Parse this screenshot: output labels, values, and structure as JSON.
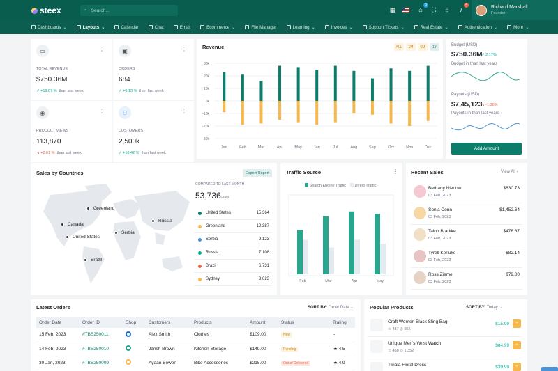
{
  "app": {
    "logo": "steex",
    "search_placeholder": "Search..."
  },
  "topbar": {
    "cart_badge": "5",
    "notif_badge": "4",
    "user_name": "Richard Marshall",
    "user_role": "Founder"
  },
  "menu": [
    {
      "label": "Dashboards",
      "caret": "⌄"
    },
    {
      "label": "Layouts",
      "caret": "⌄"
    },
    {
      "label": "Calendar",
      "caret": ""
    },
    {
      "label": "Chat",
      "caret": ""
    },
    {
      "label": "Email",
      "caret": ""
    },
    {
      "label": "Ecommerce",
      "caret": "⌄"
    },
    {
      "label": "File Manager",
      "caret": ""
    },
    {
      "label": "Learning",
      "caret": "⌄"
    },
    {
      "label": "Invoices",
      "caret": "⌄"
    },
    {
      "label": "Support Tickets",
      "caret": "⌄"
    },
    {
      "label": "Real Estate",
      "caret": "⌄"
    },
    {
      "label": "Authentication",
      "caret": "⌄"
    },
    {
      "label": "More",
      "caret": "⌄"
    }
  ],
  "kpis": {
    "revenue": {
      "label": "TOTAL REVENUE",
      "value": "$750.36M",
      "change": "↗ +19.07 %",
      "suffix": "than last week"
    },
    "orders": {
      "label": "ORDERS",
      "value": "684",
      "change": "↗ +8.13 %",
      "suffix": "than last week"
    },
    "views": {
      "label": "PRODUCT VIEWS",
      "value": "113,870",
      "change": "↘ +2.01 %",
      "suffix": "than last week"
    },
    "customers": {
      "label": "CUSTOMERS",
      "value": "2,500k",
      "change": "↗ +10.42 %",
      "suffix": "than last week"
    }
  },
  "revenue_chart": {
    "title": "Revenue",
    "tabs": [
      "ALL",
      "1M",
      "6M",
      "1Y"
    ]
  },
  "chart_data": {
    "type": "bar",
    "categories": [
      "Jan",
      "Feb",
      "Mar",
      "Apr",
      "May",
      "Jun",
      "Jul",
      "Aug",
      "Sep",
      "Oct",
      "Nov",
      "Dec"
    ],
    "series": [
      {
        "name": "",
        "values": [
          23,
          21,
          16,
          28,
          27,
          25,
          28,
          24,
          18,
          26,
          24,
          28
        ]
      },
      {
        "name": "",
        "values": [
          -9,
          -19,
          -18,
          -15,
          -17,
          -19,
          -17,
          -10,
          -11,
          -18,
          -20,
          -16
        ]
      }
    ],
    "yticks": [
      "30k",
      "20k",
      "10k",
      "0k",
      "-10k",
      "-20k",
      "-30k"
    ],
    "ylim": [
      -30,
      30
    ]
  },
  "budget": {
    "label": "Budget (USD)",
    "value": "$750.36M",
    "change": "↗ 2.17%",
    "sub": "Budget in than last years",
    "payouts_label": "Payouts (USD)",
    "payouts_value": "$7,45,123",
    "payouts_change": "↘ -1.36%",
    "payouts_sub": "Payouts in than last years",
    "button": "Add Amount"
  },
  "sales_countries": {
    "title": "Sales by Countries",
    "export": "Export Report",
    "compared": "COMPARED TO LAST MONTH",
    "total": "53,736",
    "total_unit": "Sales",
    "map_labels": [
      "Greenland",
      "Canada",
      "United States",
      "Serbia",
      "Russia",
      "Brazil"
    ],
    "rows": [
      {
        "name": "United States",
        "value": "15,364",
        "color": "#0d7d6b"
      },
      {
        "name": "Greenland",
        "value": "12,387",
        "color": "#f7b84b"
      },
      {
        "name": "Serbia",
        "value": "9,123",
        "color": "#4b93d6"
      },
      {
        "name": "Russia",
        "value": "7,108",
        "color": "#0ab39c"
      },
      {
        "name": "Brazil",
        "value": "6,731",
        "color": "#f06548"
      },
      {
        "name": "Sydney",
        "value": "3,023",
        "color": "#f7b84b"
      }
    ]
  },
  "traffic": {
    "title": "Traffic Source",
    "legend1": "Search Engine Traffic",
    "legend2": "Direct Traffic",
    "months": [
      "Feb",
      "Mar",
      "Apr",
      "May"
    ]
  },
  "recent_sales": {
    "title": "Recent Sales",
    "view_all": "View All",
    "items": [
      {
        "name": "Bethany Nienow",
        "date": "03 Feb, 2023",
        "amount": "$630.73"
      },
      {
        "name": "Sonia Conn",
        "date": "03 Feb, 2023",
        "amount": "$1,452.64"
      },
      {
        "name": "Talon Bradtke",
        "date": "03 Feb, 2023",
        "amount": "$478.87"
      },
      {
        "name": "Tyrell Kerluke",
        "date": "03 Feb, 2023",
        "amount": "$82.14"
      },
      {
        "name": "Ross Zieme",
        "date": "03 Feb, 2023",
        "amount": "$79.00"
      }
    ]
  },
  "orders": {
    "title": "Latest Orders",
    "sort_label": "SORT BY:",
    "sort_value": "Order Date",
    "headers": [
      "Order Date",
      "Order ID",
      "Shop",
      "Customers",
      "Products",
      "Amount",
      "Status",
      "Rating"
    ],
    "rows": [
      {
        "date": "15 Feb, 2023",
        "id": "#TBS250011",
        "customer": "Alex Smith",
        "product": "Clothes",
        "amount": "$109.00",
        "status": "New",
        "rating": "-"
      },
      {
        "date": "14 Feb, 2023",
        "id": "#TBS250010",
        "customer": "Jansh Brown",
        "product": "Kitchen Storage",
        "amount": "$149.00",
        "status": "Pending",
        "rating": "★ 4.5"
      },
      {
        "date": "30 Jan, 2023",
        "id": "#TBS250009",
        "customer": "Ayaan Bowen",
        "product": "Bike Accessories",
        "amount": "$215.00",
        "status": "Out of Delivered",
        "rating": "★ 4.9"
      }
    ]
  },
  "popular": {
    "title": "Popular Products",
    "sort_label": "SORT BY:",
    "sort_value": "Today",
    "items": [
      {
        "name": "Craft Women Black Sling Bag",
        "meta": "☆ 487   ◎ 956",
        "price": "$15.99"
      },
      {
        "name": "Unique Men's Wrist Watch",
        "meta": "☆ 458   ◎ 1,352",
        "price": "$84.99"
      },
      {
        "name": "Twiala Floral Dress",
        "meta": "",
        "price": "$39.99"
      }
    ]
  }
}
